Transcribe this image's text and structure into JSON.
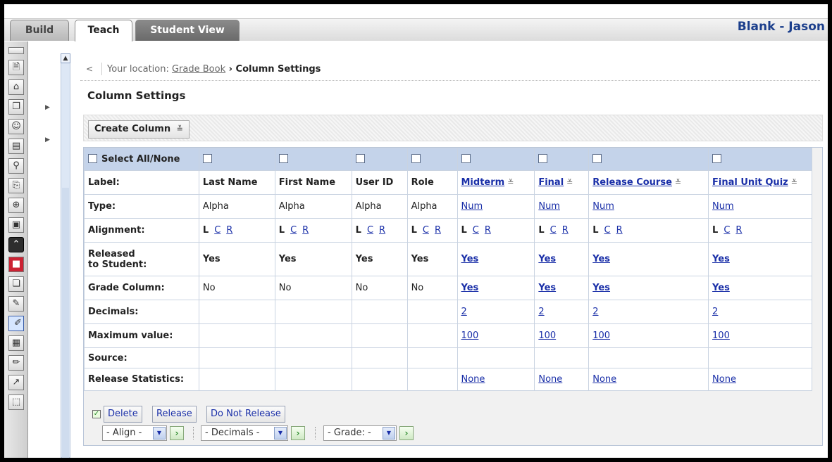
{
  "tabs": {
    "build": "Build",
    "teach": "Teach",
    "student_view": "Student View"
  },
  "user_name": "Blank - Jason",
  "breadcrumb": {
    "prefix": "Your location: ",
    "link": "Grade Book",
    "separator": " › ",
    "current": "Column Settings"
  },
  "page_title": "Column Settings",
  "create_column_label": "Create Column",
  "select_all_label": "Select All/None",
  "row_labels": {
    "label": "Label:",
    "type": "Type:",
    "alignment": "Alignment:",
    "released": "Released",
    "released2": "to Student:",
    "grade_column": "Grade Column:",
    "decimals": "Decimals:",
    "max_value": "Maximum value:",
    "source": "Source:",
    "release_stats": "Release Statistics:"
  },
  "columns": [
    {
      "label": "Last Name",
      "type": "Alpha",
      "released": "Yes",
      "grade": "No",
      "decimals": "",
      "max": "",
      "stats": ""
    },
    {
      "label": "First Name",
      "type": "Alpha",
      "released": "Yes",
      "grade": "No",
      "decimals": "",
      "max": "",
      "stats": ""
    },
    {
      "label": "User ID",
      "type": "Alpha",
      "released": "Yes",
      "grade": "No",
      "decimals": "",
      "max": "",
      "stats": ""
    },
    {
      "label": "Role",
      "type": "Alpha",
      "released": "Yes",
      "grade": "No",
      "decimals": "",
      "max": "",
      "stats": ""
    },
    {
      "label": "Midterm",
      "type": "Num",
      "released": "Yes",
      "grade": "Yes",
      "decimals": "2",
      "max": "100",
      "stats": "None"
    },
    {
      "label": "Final",
      "type": "Num",
      "released": "Yes",
      "grade": "Yes",
      "decimals": "2",
      "max": "100",
      "stats": "None"
    },
    {
      "label": "Release Course",
      "type": "Num",
      "released": "Yes",
      "grade": "Yes",
      "decimals": "2",
      "max": "100",
      "stats": "None"
    },
    {
      "label": "Final Unit Quiz",
      "type": "Num",
      "released": "Yes",
      "grade": "Yes",
      "decimals": "2",
      "max": "100",
      "stats": "None"
    }
  ],
  "align_letters": {
    "l": "L",
    "c": "C",
    "r": "R"
  },
  "buttons": {
    "delete": "Delete",
    "release": "Release",
    "do_not_release": "Do Not Release"
  },
  "selects": {
    "align": "- Align -",
    "decimals": "- Decimals -",
    "grade": "- Grade: -"
  }
}
